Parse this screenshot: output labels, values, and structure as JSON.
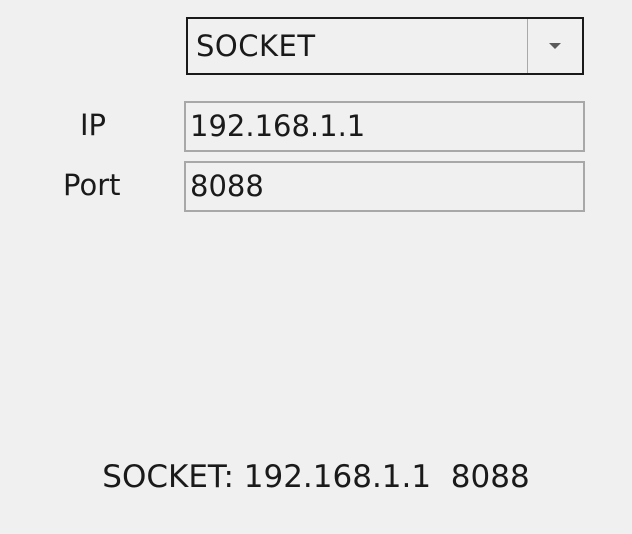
{
  "connection_select": {
    "selected": "SOCKET",
    "arrow_icon": "chevron-down-icon"
  },
  "fields": {
    "ip_label": "IP",
    "ip_value": "192.168.1.1",
    "port_label": "Port",
    "port_value": "8088"
  },
  "status_text": "SOCKET: 192.168.1.1  8088",
  "colors": {
    "background": "#f0f0f0",
    "select_border": "#1a1a1a",
    "field_border": "#a8a8a8",
    "text": "#1a1a1a"
  }
}
